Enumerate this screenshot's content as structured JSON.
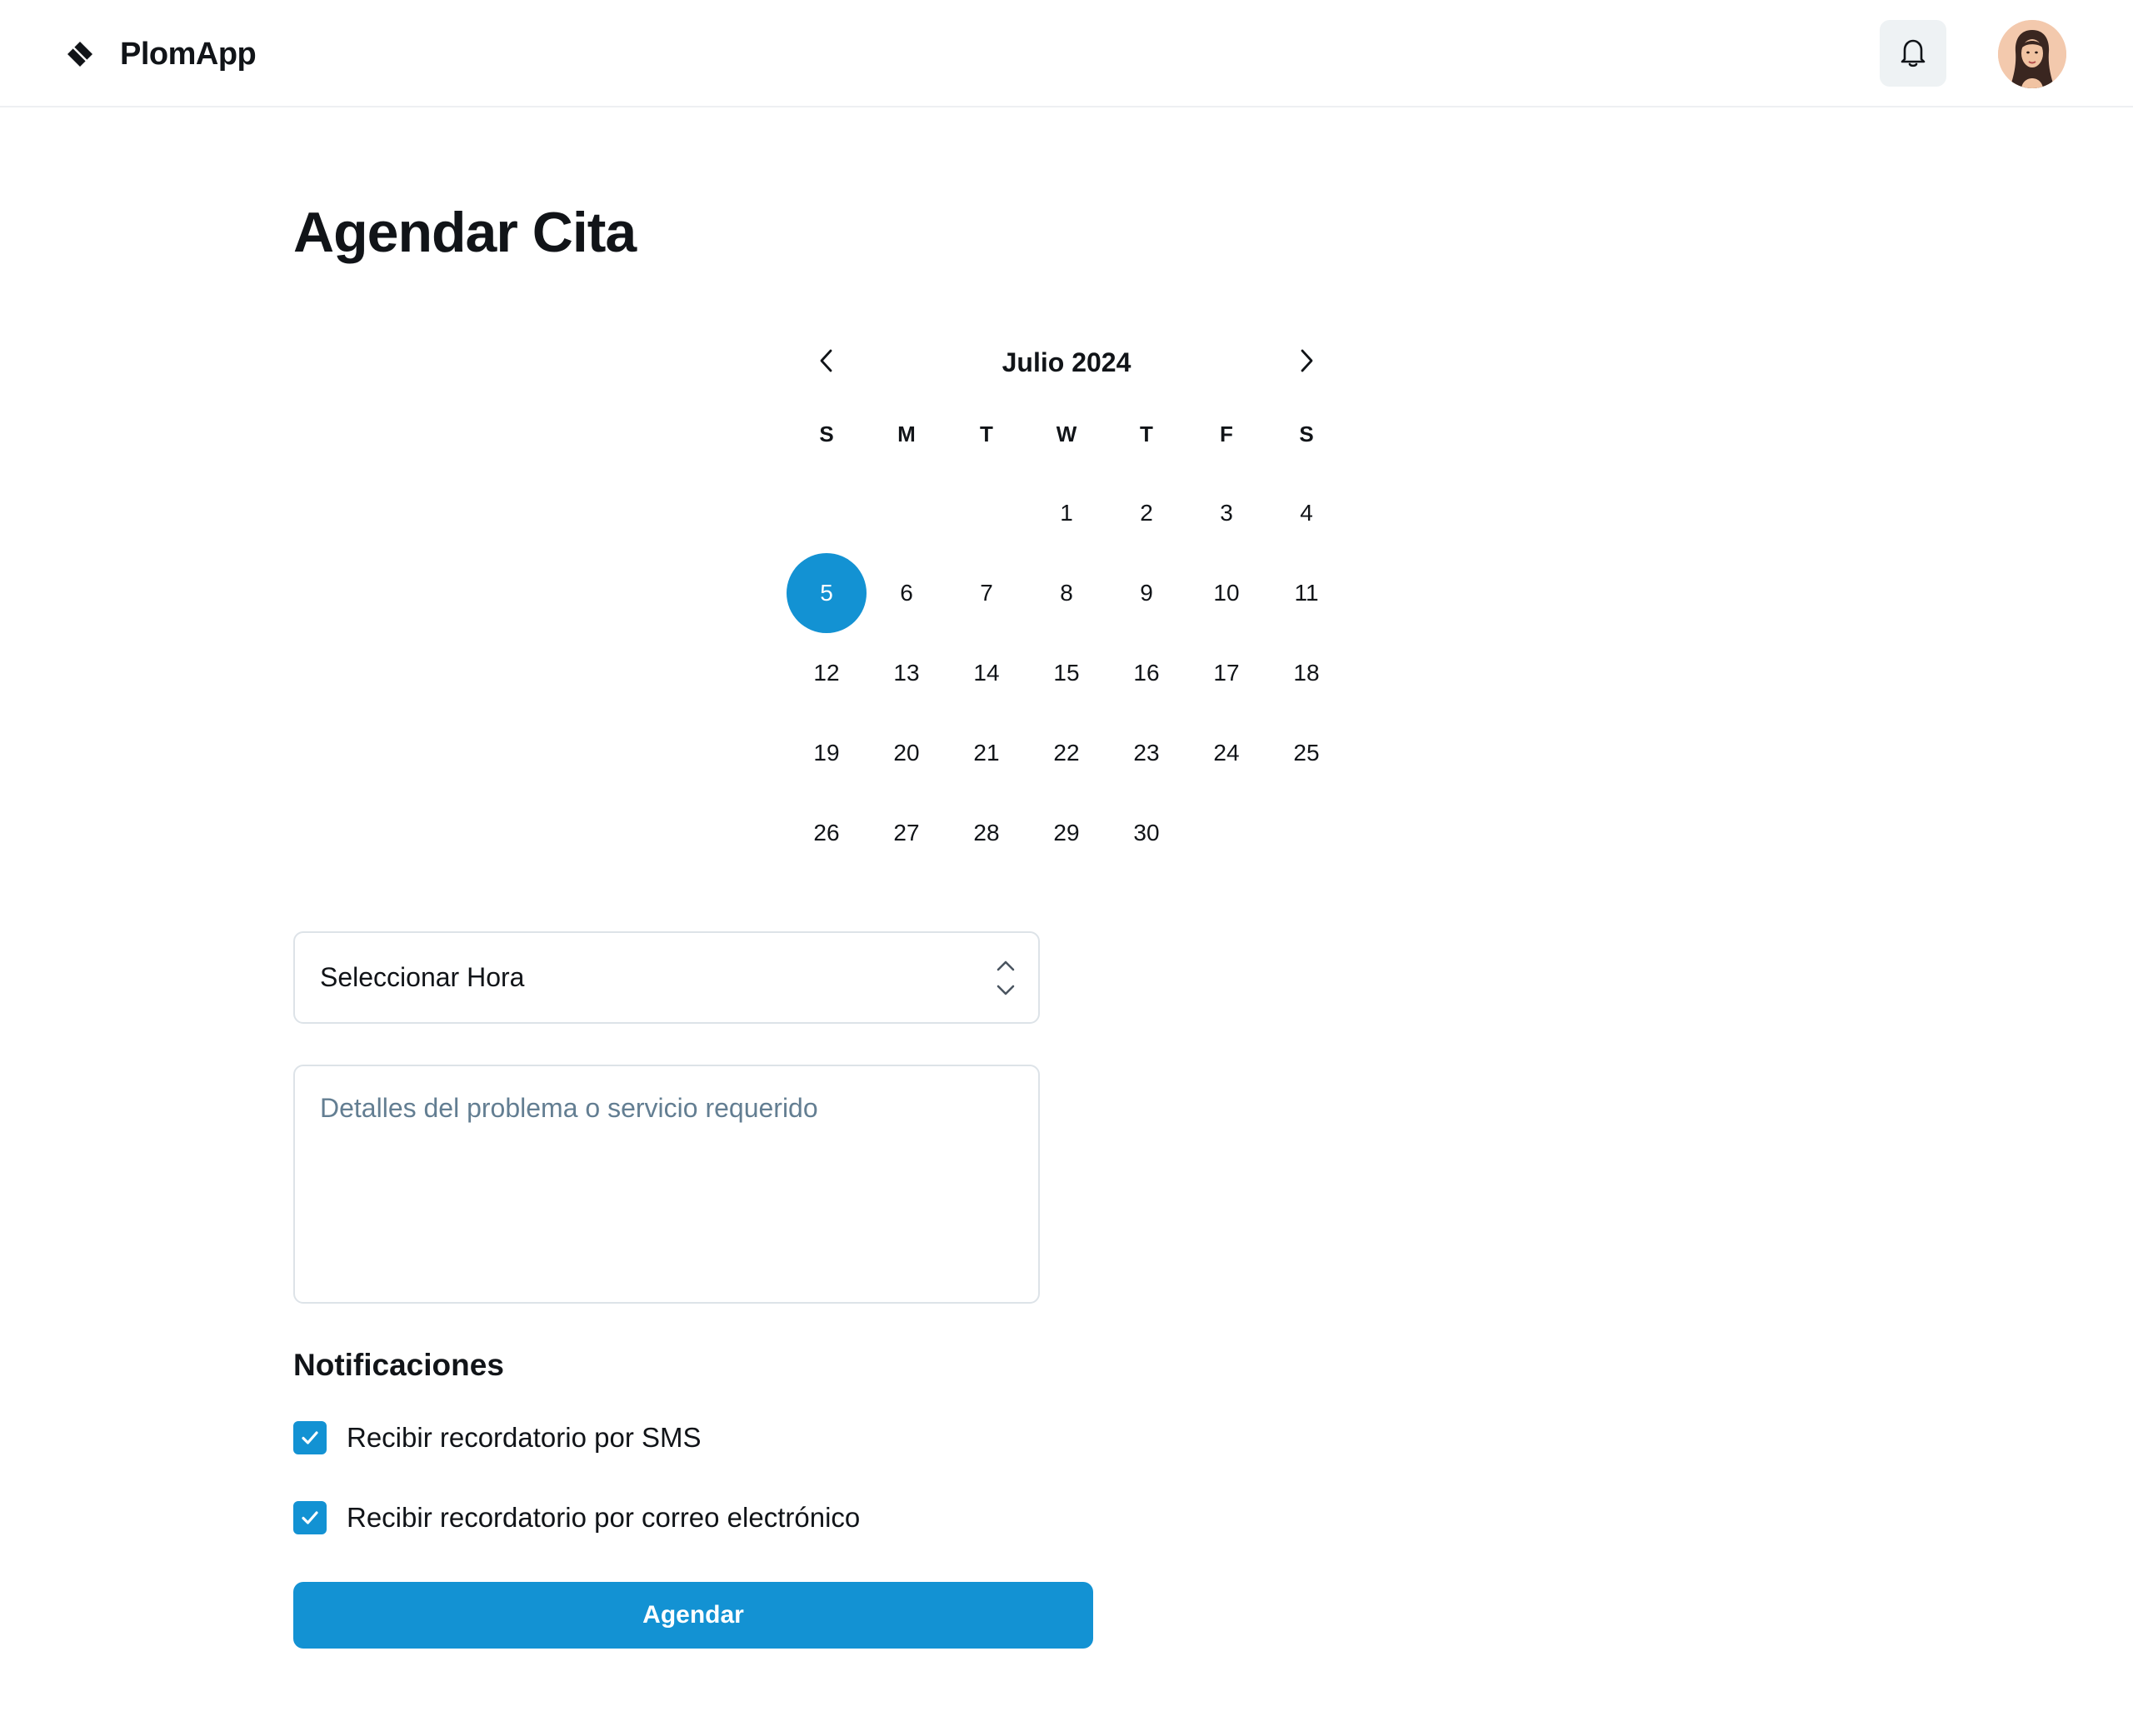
{
  "app": {
    "name": "PlomApp"
  },
  "header": {
    "notifications_icon": "bell-icon",
    "avatar_icon": "user-avatar"
  },
  "page": {
    "title": "Agendar Cita"
  },
  "calendar": {
    "month_label": "Julio 2024",
    "prev_icon": "chevron-left-icon",
    "next_icon": "chevron-right-icon",
    "weekdays": [
      "S",
      "M",
      "T",
      "W",
      "T",
      "F",
      "S"
    ],
    "leading_blanks": 3,
    "days": [
      "1",
      "2",
      "3",
      "4",
      "5",
      "6",
      "7",
      "8",
      "9",
      "10",
      "11",
      "12",
      "13",
      "14",
      "15",
      "16",
      "17",
      "18",
      "19",
      "20",
      "21",
      "22",
      "23",
      "24",
      "25",
      "26",
      "27",
      "28",
      "29",
      "30"
    ],
    "selected_day": "5"
  },
  "form": {
    "time_select_label": "Seleccionar Hora",
    "details_placeholder": "Detalles del problema o servicio requerido",
    "notifications_title": "Notificaciones",
    "sms_label": "Recibir recordatorio por SMS",
    "email_label": "Recibir recordatorio por correo electrónico",
    "sms_checked": true,
    "email_checked": true,
    "submit_label": "Agendar"
  },
  "colors": {
    "accent": "#1392d3",
    "text": "#111418",
    "placeholder": "#637e92",
    "border": "#dde3e8"
  }
}
